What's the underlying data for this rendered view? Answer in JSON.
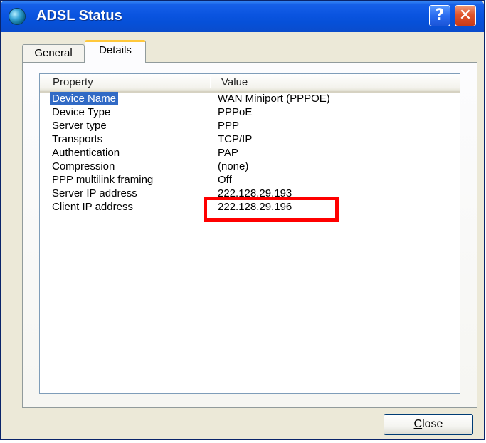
{
  "window": {
    "title": "ADSL Status",
    "help_glyph": "?",
    "close_glyph": "✕"
  },
  "tabs": [
    {
      "label": "General",
      "selected": false
    },
    {
      "label": "Details",
      "selected": true
    }
  ],
  "details": {
    "columns": {
      "property": "Property",
      "value": "Value"
    },
    "rows": [
      {
        "property": "Device Name",
        "value": "WAN Miniport (PPPOE)",
        "selected": true
      },
      {
        "property": "Device Type",
        "value": "PPPoE"
      },
      {
        "property": "Server type",
        "value": "PPP"
      },
      {
        "property": "Transports",
        "value": "TCP/IP"
      },
      {
        "property": "Authentication",
        "value": "PAP"
      },
      {
        "property": "Compression",
        "value": "(none)"
      },
      {
        "property": "PPP multilink framing",
        "value": "Off"
      },
      {
        "property": "Server IP address",
        "value": "222.128.29.193"
      },
      {
        "property": "Client IP address",
        "value": "222.128.29.196"
      }
    ]
  },
  "buttons": {
    "close": {
      "mnemonic": "C",
      "rest": "lose"
    }
  },
  "colors": {
    "titlebar": "#0a54e0",
    "selection": "#316ac5",
    "annotation": "#ff0000",
    "tab_accent": "#ffc83c"
  },
  "icons": {
    "title": "network-globe-icon",
    "help": "help-icon",
    "close": "close-icon"
  }
}
